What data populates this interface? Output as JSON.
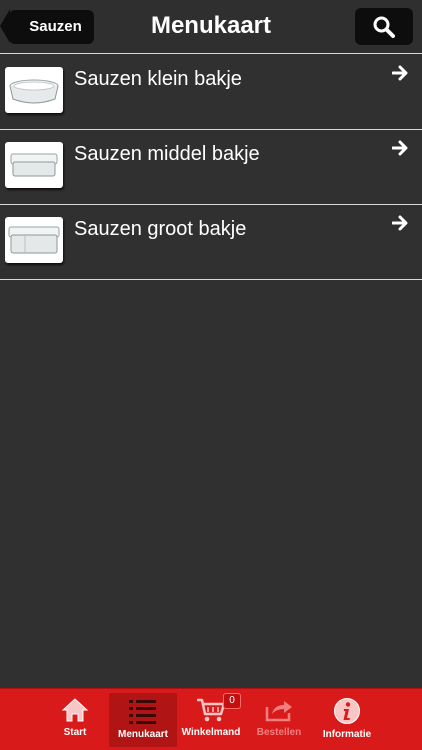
{
  "header": {
    "back_label": "Sauzen",
    "title": "Menukaart",
    "search_icon": "search-icon"
  },
  "items": [
    {
      "label": "Sauzen klein bakje",
      "icon": "arrow-right-icon"
    },
    {
      "label": "Sauzen middel bakje",
      "icon": "arrow-right-icon"
    },
    {
      "label": "Sauzen groot bakje",
      "icon": "arrow-right-icon"
    }
  ],
  "tabbar": {
    "tabs": [
      {
        "label": "Start",
        "icon": "home-icon"
      },
      {
        "label": "Menukaart",
        "icon": "list-icon",
        "active": true
      },
      {
        "label": "Winkelmand",
        "icon": "cart-icon",
        "badge": "0"
      },
      {
        "label": "Bestellen",
        "icon": "share-icon",
        "disabled": true
      },
      {
        "label": "Informatie",
        "icon": "info-icon"
      }
    ]
  },
  "colors": {
    "background": "#303030",
    "tabbar": "#d91a1a",
    "button": "#0d0d0d"
  }
}
